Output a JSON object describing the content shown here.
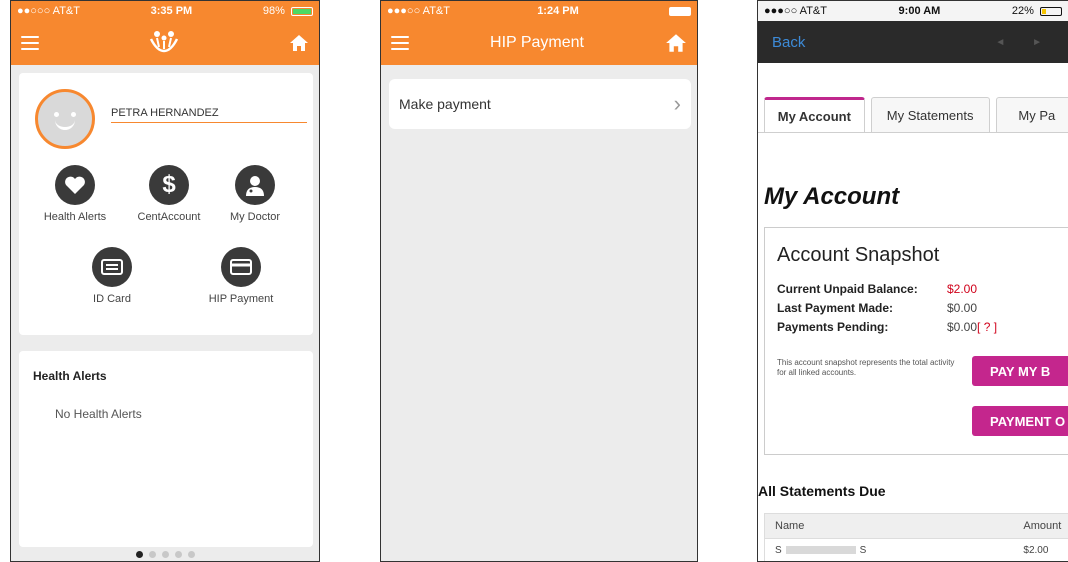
{
  "screen1": {
    "status": {
      "carrier": "●●○○○ AT&T",
      "time": "3:35 PM",
      "battery": "98%",
      "battery_level": 0.98
    },
    "user_name": "PETRA HERNANDEZ",
    "icons": [
      {
        "label": "Health Alerts",
        "icon": "heart-icon"
      },
      {
        "label": "CentAccount",
        "icon": "dollar-icon"
      },
      {
        "label": "My Doctor",
        "icon": "doctor-icon"
      },
      {
        "label": "ID Card",
        "icon": "id-card-icon"
      },
      {
        "label": "HIP Payment",
        "icon": "credit-card-icon"
      }
    ],
    "alerts_title": "Health Alerts",
    "alerts_empty": "No Health Alerts",
    "page_count": 5,
    "page_active": 1,
    "brand_color": "#f7882f"
  },
  "screen2": {
    "status": {
      "carrier": "●●●○○ AT&T",
      "time": "1:24 PM"
    },
    "title": "HIP Payment",
    "menu_item": "Make payment"
  },
  "screen3": {
    "status": {
      "carrier": "●●●○○ AT&T",
      "time": "9:00 AM",
      "battery": "22%",
      "battery_level": 0.22
    },
    "back_label": "Back",
    "tabs": [
      "My Account",
      "My Statements",
      "My Pa"
    ],
    "heading": "My Account",
    "snapshot_title": "Account Snapshot",
    "rows": [
      {
        "label": "Current Unpaid Balance:",
        "value": "$2.00"
      },
      {
        "label": "Last Payment Made:",
        "value": "$0.00"
      },
      {
        "label": "Payments Pending:",
        "value": "$0.00",
        "help": "[ ? ]"
      }
    ],
    "note": "This account snapshot represents the total activity for all linked accounts.",
    "pay_button": "PAY MY B",
    "payment_button": "PAYMENT O",
    "statements_title": "All Statements Due",
    "table_headers": [
      "Name",
      "Amount"
    ],
    "table_rows": [
      {
        "name_start": "S",
        "name_end": "S",
        "amount": "$2.00"
      }
    ],
    "accent_color": "#c4268d"
  }
}
